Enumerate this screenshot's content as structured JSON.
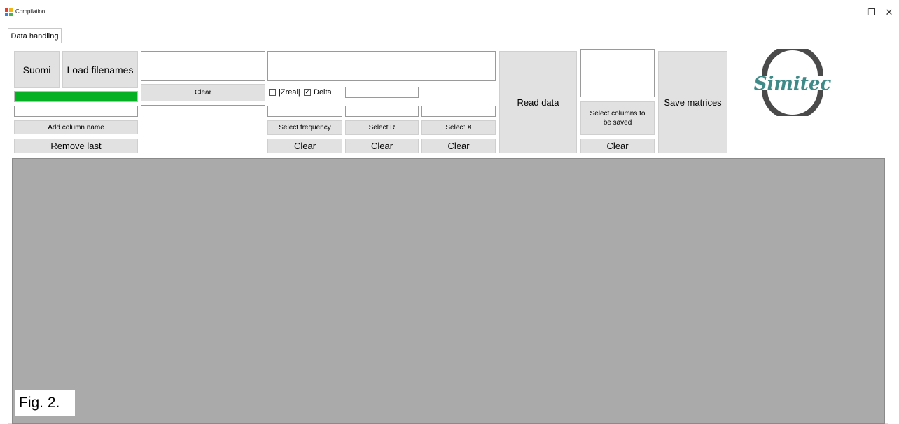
{
  "window": {
    "title": "Compilation",
    "controls": [
      "–",
      "❐",
      "✕"
    ]
  },
  "tabs": [
    {
      "label": "Data handling"
    }
  ],
  "left": {
    "suomi": "Suomi",
    "load_filenames": "Load filenames",
    "progress_fraction": 1.0,
    "column_name_value": "",
    "add_column_name": "Add column name",
    "remove_last": "Remove last"
  },
  "files": {
    "clear": "Clear"
  },
  "selection": {
    "zreal_label": "|Zreal|",
    "zreal_checked": false,
    "delta_label": "Delta",
    "delta_checked": true,
    "select_frequency": "Select frequency",
    "select_r": "Select R",
    "select_x": "Select X",
    "clear": "Clear"
  },
  "read_data": "Read data",
  "columns": {
    "select_columns": "Select columns to be saved",
    "clear": "Clear"
  },
  "save_matrices": "Save matrices",
  "logo": {
    "text": "Simitec",
    "color": "#3f8a88"
  },
  "figure_label": "Fig. 2."
}
